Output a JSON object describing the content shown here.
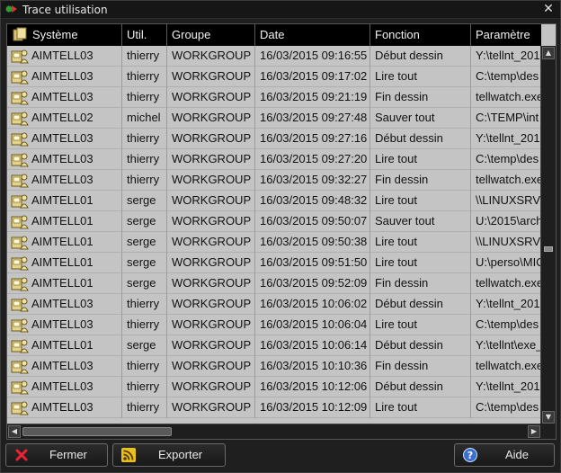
{
  "window": {
    "title": "Trace utilisation"
  },
  "columns": [
    "Système",
    "Util.",
    "Groupe",
    "Date",
    "Fonction",
    "Paramètre"
  ],
  "rows": [
    [
      "AIMTELL03",
      "thierry",
      "WORKGROUP",
      "16/03/2015 09:16:55",
      "Début dessin",
      "Y:\\tellnt_201"
    ],
    [
      "AIMTELL03",
      "thierry",
      "WORKGROUP",
      "16/03/2015 09:17:02",
      "Lire tout",
      "C:\\temp\\des"
    ],
    [
      "AIMTELL03",
      "thierry",
      "WORKGROUP",
      "16/03/2015 09:21:19",
      "Fin dessin",
      "tellwatch.exe"
    ],
    [
      "AIMTELL02",
      "michel",
      "WORKGROUP",
      "16/03/2015 09:27:48",
      "Sauver tout",
      "C:\\TEMP\\int"
    ],
    [
      "AIMTELL03",
      "thierry",
      "WORKGROUP",
      "16/03/2015 09:27:16",
      "Début dessin",
      "Y:\\tellnt_201"
    ],
    [
      "AIMTELL03",
      "thierry",
      "WORKGROUP",
      "16/03/2015 09:27:20",
      "Lire tout",
      "C:\\temp\\des"
    ],
    [
      "AIMTELL03",
      "thierry",
      "WORKGROUP",
      "16/03/2015 09:32:27",
      "Fin dessin",
      "tellwatch.exe"
    ],
    [
      "AIMTELL01",
      "serge",
      "WORKGROUP",
      "16/03/2015 09:48:32",
      "Lire tout",
      "\\\\LINUXSRV\\"
    ],
    [
      "AIMTELL01",
      "serge",
      "WORKGROUP",
      "16/03/2015 09:50:07",
      "Sauver tout",
      "U:\\2015\\arch"
    ],
    [
      "AIMTELL01",
      "serge",
      "WORKGROUP",
      "16/03/2015 09:50:38",
      "Lire tout",
      "\\\\LINUXSRV\\"
    ],
    [
      "AIMTELL01",
      "serge",
      "WORKGROUP",
      "16/03/2015 09:51:50",
      "Lire tout",
      "U:\\perso\\MIC"
    ],
    [
      "AIMTELL01",
      "serge",
      "WORKGROUP",
      "16/03/2015 09:52:09",
      "Fin dessin",
      "tellwatch.exe"
    ],
    [
      "AIMTELL03",
      "thierry",
      "WORKGROUP",
      "16/03/2015 10:06:02",
      "Début dessin",
      "Y:\\tellnt_201"
    ],
    [
      "AIMTELL03",
      "thierry",
      "WORKGROUP",
      "16/03/2015 10:06:04",
      "Lire tout",
      "C:\\temp\\des"
    ],
    [
      "AIMTELL01",
      "serge",
      "WORKGROUP",
      "16/03/2015 10:06:14",
      "Début dessin",
      "Y:\\tellnt\\exe_"
    ],
    [
      "AIMTELL03",
      "thierry",
      "WORKGROUP",
      "16/03/2015 10:10:36",
      "Fin dessin",
      "tellwatch.exe"
    ],
    [
      "AIMTELL03",
      "thierry",
      "WORKGROUP",
      "16/03/2015 10:12:06",
      "Début dessin",
      "Y:\\tellnt_201"
    ],
    [
      "AIMTELL03",
      "thierry",
      "WORKGROUP",
      "16/03/2015 10:12:09",
      "Lire tout",
      "C:\\temp\\des"
    ]
  ],
  "icons": {
    "row": "computer-user-icon",
    "header": "system-icon"
  },
  "buttons": {
    "close_label": "Fermer",
    "export_label": "Exporter",
    "help_label": "Aide"
  },
  "colors": {
    "header_bg": "#000000",
    "row_bg": "#c4c4c4",
    "window_bg": "#1f1f1f"
  }
}
